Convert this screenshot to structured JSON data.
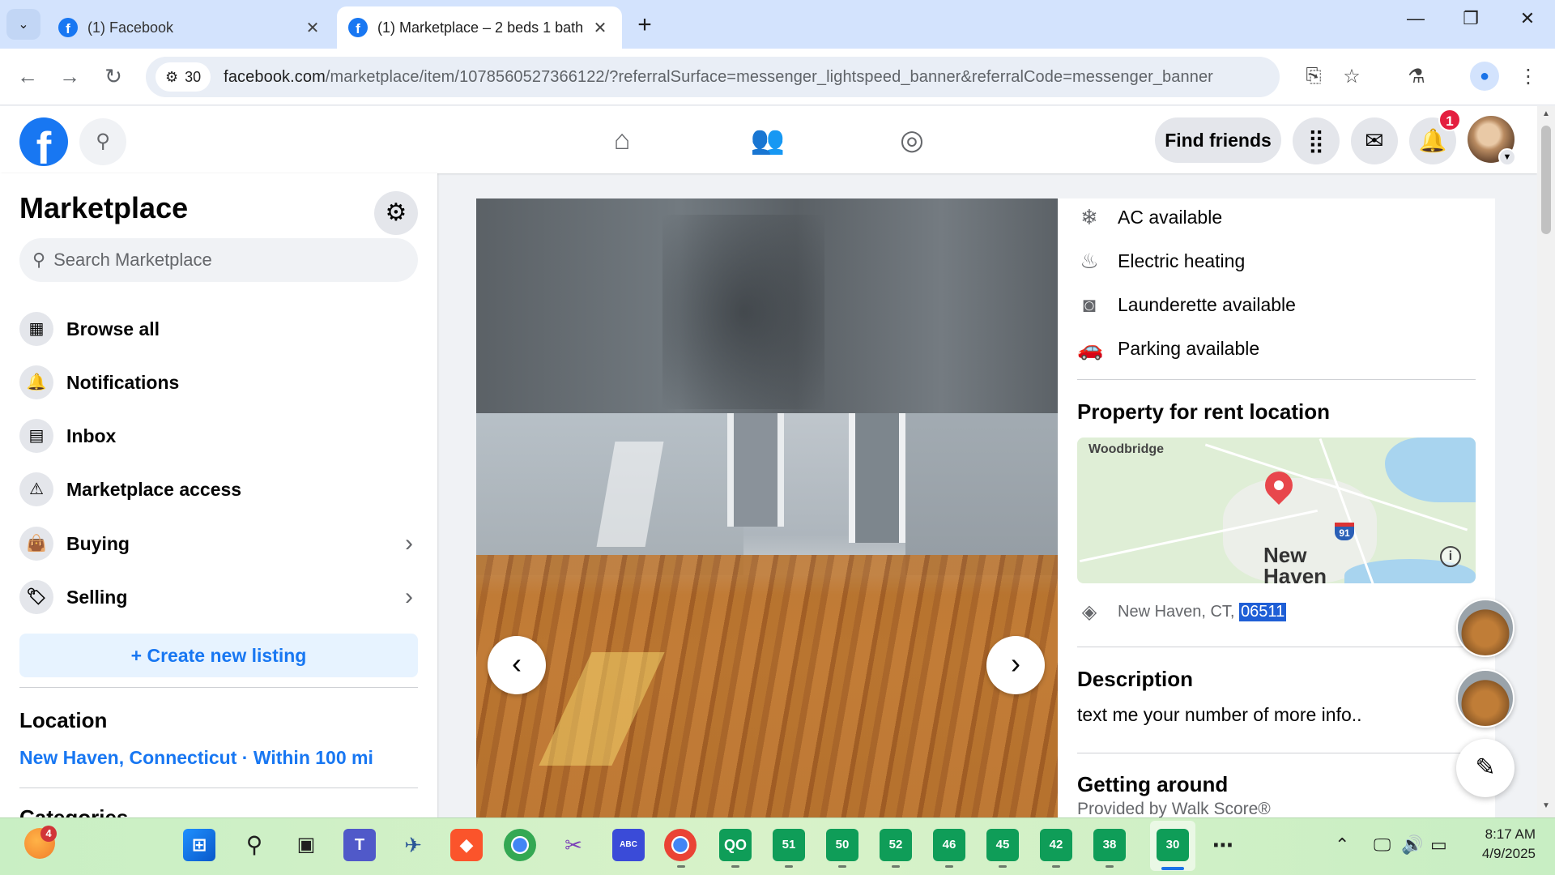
{
  "browser": {
    "tabs": [
      {
        "title": "(1) Facebook",
        "active": false
      },
      {
        "title": "(1) Marketplace – 2 beds 1 bath",
        "active": true
      }
    ],
    "site_settings_badge": "30",
    "url_host": "facebook.com",
    "url_rest": "/marketplace/item/1078560527366122/?referralSurface=messenger_lightspeed_banner&referralCode=messenger_banner"
  },
  "facebook": {
    "find_friends_label": "Find friends",
    "notification_count": "1"
  },
  "sidebar": {
    "title": "Marketplace",
    "search_placeholder": "Search Marketplace",
    "items": [
      {
        "label": "Browse all",
        "icon": "storefront-icon"
      },
      {
        "label": "Notifications",
        "icon": "bell-icon"
      },
      {
        "label": "Inbox",
        "icon": "inbox-icon"
      },
      {
        "label": "Marketplace access",
        "icon": "warning-icon"
      },
      {
        "label": "Buying",
        "icon": "shopping-bag-icon"
      },
      {
        "label": "Selling",
        "icon": "tag-icon"
      }
    ],
    "create_listing_label": "Create new listing",
    "location_heading": "Location",
    "location_value": "New Haven, Connecticut · Within 100 mi",
    "categories_heading": "Categories"
  },
  "listing": {
    "amenities": [
      {
        "label": "AC available",
        "icon": "snowflake-icon"
      },
      {
        "label": "Electric heating",
        "icon": "heating-icon"
      },
      {
        "label": "Launderette available",
        "icon": "washing-machine-icon"
      },
      {
        "label": "Parking available",
        "icon": "car-icon"
      }
    ],
    "location_heading": "Property for rent location",
    "map_labels": {
      "town": "Woodbridge",
      "city_line1": "New",
      "city_line2": "Haven",
      "highway": "91"
    },
    "address_prefix": "New Haven, CT,",
    "address_zip": "06511",
    "description_heading": "Description",
    "description": "text me your number of more info..",
    "getting_around_heading": "Getting around",
    "walk_score": "Provided by Walk Score®"
  },
  "taskbar": {
    "weather_badge": "4",
    "pinned_labels": [
      "51",
      "50",
      "52",
      "46",
      "45",
      "42",
      "38",
      "30"
    ],
    "time": "8:17 AM",
    "date": "4/9/2025"
  }
}
